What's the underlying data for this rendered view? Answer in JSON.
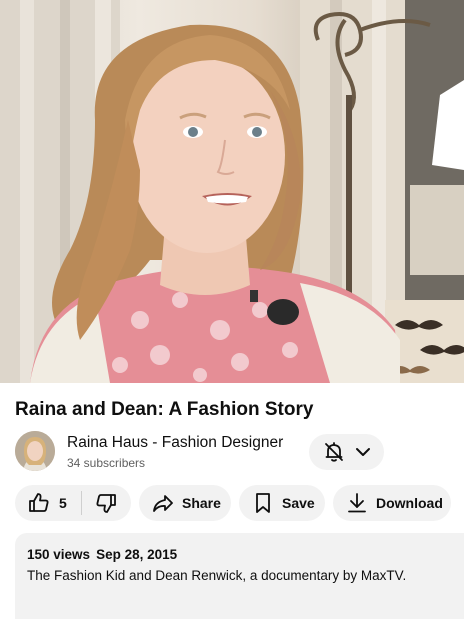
{
  "video": {
    "thumbnail": "girl-speaking-in-interview"
  },
  "title": "Raina and Dean: A Fashion Story",
  "channel": {
    "name": "Raina Haus - Fashion Designer",
    "subscribers": "34 subscribers",
    "bell_icon": "bell-off-icon",
    "dropdown_icon": "chevron-down-icon"
  },
  "actions": {
    "like_count": "5",
    "share_label": "Share",
    "save_label": "Save",
    "download_label": "Download"
  },
  "description": {
    "views": "150 views",
    "date": "Sep 28, 2015",
    "text": "The Fashion Kid and Dean Renwick, a documentary by MaxTV."
  },
  "colors": {
    "pill_bg": "#f2f2f2",
    "text": "#0f0f0f",
    "secondary_text": "#606060"
  }
}
